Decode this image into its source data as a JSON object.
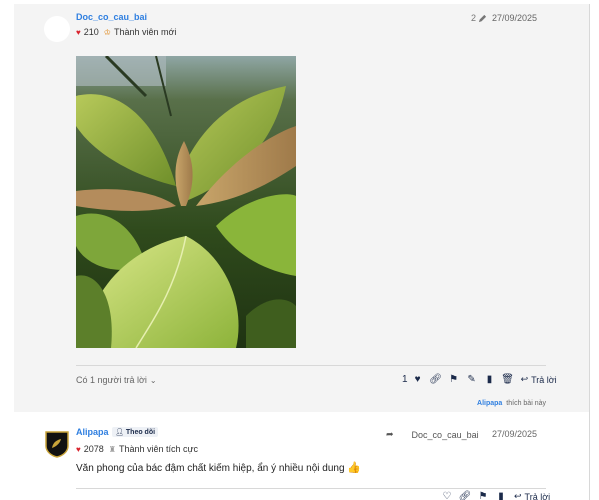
{
  "post1": {
    "username": "Doc_co_cau_bai",
    "likes_count": "210",
    "rank_label": "Thành viên mới",
    "edit_count": "2",
    "date": "27/09/2025",
    "replies_label": "Có 1 người trả lời",
    "like_count": "1",
    "reply_label": "Trả lời",
    "liker": "Alipapa",
    "likes_suffix": "thích bài này"
  },
  "post2": {
    "username": "Alipapa",
    "follow_label": "Theo dõi",
    "likes_count": "2078",
    "rank_label": "Thành viên tích cực",
    "reply_to_user": "Doc_co_cau_bai",
    "date": "27/09/2025",
    "content": "Văn phong của bác đậm chất kiếm hiệp, ẩn ý nhiều nội dung",
    "emoji": "👍",
    "reply_label": "Trả lời"
  },
  "icons": {
    "heart": "heart-icon",
    "rank": "rank-icon",
    "pencil": "pencil-icon",
    "link": "link-icon",
    "flag": "flag-icon",
    "edit": "edit-icon",
    "bookmark": "bookmark-icon",
    "trash": "trash-icon",
    "reply": "reply-icon",
    "follow": "follow-user-icon"
  },
  "colors": {
    "link": "#2f7fe0",
    "heart": "#d9232d",
    "action": "#1b2a4a",
    "post_bg": "#f4f4f4"
  }
}
